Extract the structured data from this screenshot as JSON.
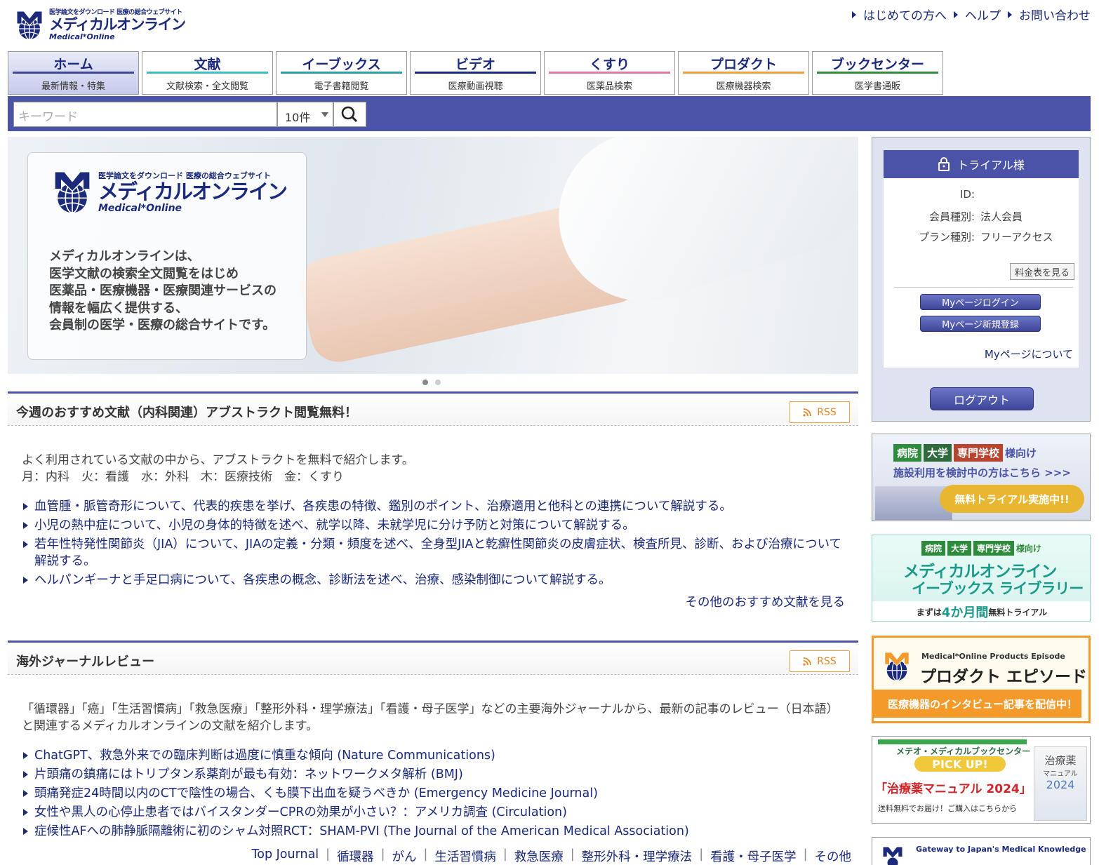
{
  "header": {
    "logo": {
      "tagline": "医学論文をダウンロード 医療の総合ウェブサイト",
      "name": "メディカルオンライン",
      "name_en": "Medical*Online"
    },
    "links": [
      "はじめての方へ",
      "ヘルプ",
      "お問い合わせ"
    ]
  },
  "tabs": [
    {
      "title": "ホーム",
      "sub": "最新情報・特集",
      "color": "#3d4699",
      "active": true
    },
    {
      "title": "文献",
      "sub": "文献検索・全文閲覧",
      "color": "#3dbfbf"
    },
    {
      "title": "イーブックス",
      "sub": "電子書籍閲覧",
      "color": "#2f9ea6"
    },
    {
      "title": "ビデオ",
      "sub": "医療動画視聴",
      "color": "#1b2a7a"
    },
    {
      "title": "くすり",
      "sub": "医薬品検索",
      "color": "#e27aa8"
    },
    {
      "title": "プロダクト",
      "sub": "医療機器検索",
      "color": "#f0a040"
    },
    {
      "title": "ブックセンター",
      "sub": "医学書通販",
      "color": "#2e8b3c"
    }
  ],
  "search": {
    "placeholder": "キーワード",
    "count": "10件"
  },
  "banner": {
    "tagline": "医学論文をダウンロード 医療の総合ウェブサイト",
    "name": "メディカルオンライン",
    "name_en": "Medical*Online",
    "lines": [
      "メディカルオンラインは、",
      "医学文献の検索全文閲覧をはじめ",
      "医薬品・医療機器・医療関連サービスの",
      "情報を幅広く提供する、",
      "会員制の医学・医療の総合サイトです。"
    ]
  },
  "recommend": {
    "title": "今週のおすすめ文献（内科関連）アブストラクト閲覧無料！",
    "rss": "RSS",
    "intro": [
      "よく利用されている文献の中から、アブストラクトを無料で紹介します。",
      "月：内科　火：看護　水：外科　木：医療技術　金：くすり"
    ],
    "items": [
      "血管腫・脈管奇形について、代表的疾患を挙げ、各疾患の特徴、鑑別のポイント、治療適用と他科との連携について解説する。",
      "小児の熱中症について、小児の身体的特徴を述べ、就学以降、未就学児に分け予防と対策について解説する。",
      "若年性特発性関節炎（JIA）について、JIAの定義・分類・頻度を述べ、全身型JIAと乾癬性関節炎の皮膚症状、検査所見、診断、および治療について解説する。",
      "ヘルパンギーナと手足口病について、各疾患の概念、診断法を述べ、治療、感染制御について解説する。"
    ],
    "more": "その他のおすすめ文献を見る"
  },
  "journal": {
    "title": "海外ジャーナルレビュー",
    "rss": "RSS",
    "intro": "「循環器」「癌」「生活習慣病」「救急医療」「整形外科・理学療法」「看護・母子医学」などの主要海外ジャーナルから、最新の記事のレビュー（日本語）と関連するメディカルオンラインの文献を紹介します。",
    "items": [
      "ChatGPT、救急外来での臨床判断は過度に慎重な傾向 (Nature Communications)",
      "片頭痛の鎮痛にはトリプタン系薬剤が最も有効：ネットワークメタ解析 (BMJ)",
      "頭痛発症24時間以内のCTで陰性の場合、くも膜下出血を疑うべきか (Emergency Medicine Journal)",
      "女性や黒人の心停止患者ではバイスタンダーCPRの効果が小さい？：アメリカ調査 (Circulation)",
      "症候性AFへの肺静脈隔離術に初のシャム対照RCT：SHAM-PVI (The Journal of the American Medical Association)"
    ],
    "categories": [
      "Top Journal",
      "循環器",
      "がん",
      "生活習慣病",
      "救急医療",
      "整形外科・理学療法",
      "看護・母子医学",
      "その他"
    ]
  },
  "sidebar": {
    "header": "トライアル様",
    "id_label": "ID:",
    "member_label": "会員種別:",
    "member_value": "法人会員",
    "plan_label": "プラン種別:",
    "plan_value": "フリーアクセス",
    "price_button": "料金表を見る",
    "login_button": "Myページログイン",
    "register_button": "Myページ新規登録",
    "about": "Myページについて",
    "logout": "ログアウト"
  },
  "ads": {
    "ad1": {
      "badges": [
        "病院",
        "大学",
        "専門学校"
      ],
      "badge_suffix": "様向け",
      "line": "施設利用を検討中の方はこちら >>>",
      "cta": "無料トライアル実施中!!"
    },
    "ad2": {
      "badges": [
        "病院",
        "大学",
        "専門学校"
      ],
      "badge_suffix": "様向け",
      "title1": "メディカルオンライン",
      "title2": "イーブックス ライブラリー",
      "foot_pre": "まずは",
      "foot_em": "4か月間",
      "foot_post": "無料トライアル"
    },
    "ad3": {
      "sub": "Medical*Online Products Episode",
      "title": "プロダクト エピソード",
      "cta": "医療機器のインタビュー記事を配信中！"
    },
    "ad4": {
      "head": "メテオ・メディカルブックセンター",
      "pick": "PICK UP!",
      "book": "「治療薬マニュアル 2024」",
      "foot": "送料無料でお届け！ご購入はこちらから",
      "cover_title": "治療薬",
      "cover_sub": "マニュアル",
      "cover_year": "2024"
    },
    "ad5": {
      "text": "Gateway to Japan's Medical Knowledge"
    }
  }
}
